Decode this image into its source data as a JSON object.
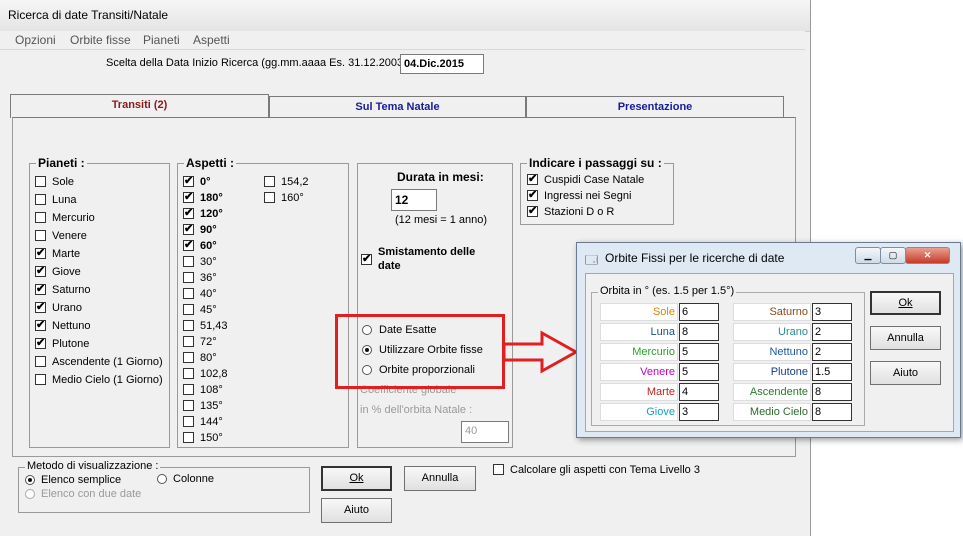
{
  "window": {
    "title": "Ricerca di date Transiti/Natale"
  },
  "menu": [
    "Opzioni",
    "Orbite fisse",
    "Pianeti",
    "Aspetti"
  ],
  "date_input": {
    "label": "Scelta della Data Inizio Ricerca (gg.mm.aaaa Es. 31.12.2003):",
    "value": "04.Dic.2015"
  },
  "tabs": [
    "Transiti (2)",
    "Sul Tema Natale",
    "Presentazione"
  ],
  "pianeti": {
    "label": "Pianeti :",
    "items": [
      {
        "label": "Sole",
        "checked": false
      },
      {
        "label": "Luna",
        "checked": false
      },
      {
        "label": "Mercurio",
        "checked": false
      },
      {
        "label": "Venere",
        "checked": false
      },
      {
        "label": "Marte",
        "checked": true
      },
      {
        "label": "Giove",
        "checked": true
      },
      {
        "label": "Saturno",
        "checked": true
      },
      {
        "label": "Urano",
        "checked": true
      },
      {
        "label": "Nettuno",
        "checked": true
      },
      {
        "label": "Plutone",
        "checked": true
      },
      {
        "label": "Ascendente (1 Giorno)",
        "checked": false
      },
      {
        "label": "Medio Cielo (1 Giorno)",
        "checked": false
      }
    ]
  },
  "aspetti": {
    "label": "Aspetti :",
    "col1": [
      {
        "label": "0°",
        "checked": true,
        "bold": true
      },
      {
        "label": "180°",
        "checked": true,
        "bold": true
      },
      {
        "label": "120°",
        "checked": true,
        "bold": true
      },
      {
        "label": "90°",
        "checked": true,
        "bold": true
      },
      {
        "label": "60°",
        "checked": true,
        "bold": true
      },
      {
        "label": "30°",
        "checked": false,
        "bold": false
      },
      {
        "label": "36°",
        "checked": false,
        "bold": false
      },
      {
        "label": "40°",
        "checked": false,
        "bold": false
      },
      {
        "label": "45°",
        "checked": false,
        "bold": false
      },
      {
        "label": "51,43",
        "checked": false,
        "bold": false
      },
      {
        "label": "72°",
        "checked": false,
        "bold": false
      },
      {
        "label": "80°",
        "checked": false,
        "bold": false
      },
      {
        "label": "102,8",
        "checked": false,
        "bold": false
      },
      {
        "label": "108°",
        "checked": false,
        "bold": false
      },
      {
        "label": "135°",
        "checked": false,
        "bold": false
      },
      {
        "label": "144°",
        "checked": false,
        "bold": false
      },
      {
        "label": "150°",
        "checked": false,
        "bold": false
      }
    ],
    "col2": [
      {
        "label": "154,2",
        "checked": false
      },
      {
        "label": "160°",
        "checked": false
      }
    ]
  },
  "durata": {
    "label": "Durata in mesi:",
    "value": "12",
    "note": "(12 mesi = 1 anno)",
    "smistamento": "Smistamento delle date",
    "smistamento_checked": true,
    "radios": [
      {
        "label": "Date Esatte",
        "selected": false
      },
      {
        "label": "Utilizzare Orbite fisse",
        "selected": true
      },
      {
        "label": "Orbite proporzionali",
        "selected": false
      }
    ],
    "coeff_line1": "Coefficiente globale",
    "coeff_line2": "in % dell'orbita Natale :",
    "coeff_value": "40"
  },
  "passaggi": {
    "label": "Indicare i passaggi su :",
    "items": [
      {
        "label": "Cuspidi Case Natale",
        "checked": true
      },
      {
        "label": "Ingressi nei Segni",
        "checked": true
      },
      {
        "label": "Stazioni D o R",
        "checked": true
      }
    ]
  },
  "metodo": {
    "label": "Metodo di visualizzazione :",
    "options": [
      {
        "label": "Elenco semplice",
        "selected": true,
        "disabled": false
      },
      {
        "label": "Colonne",
        "selected": false,
        "disabled": false
      },
      {
        "label": "Elenco con due date",
        "selected": false,
        "disabled": true
      }
    ]
  },
  "buttons": {
    "ok": "Ok",
    "annulla": "Annulla",
    "aiuto": "Aiuto"
  },
  "livello3": {
    "label": "Calcolare gli aspetti con Tema Livello 3",
    "checked": false
  },
  "popup": {
    "title": "Orbite Fissi per le ricerche di date",
    "group_label": "Orbita in ° (es. 1.5 per 1.5°)",
    "left": [
      {
        "name": "Sole",
        "value": "6",
        "color": "#e08000"
      },
      {
        "name": "Luna",
        "value": "8",
        "color": "#1a4f8a"
      },
      {
        "name": "Mercurio",
        "value": "5",
        "color": "#2aa02a"
      },
      {
        "name": "Venere",
        "value": "5",
        "color": "#c000c0"
      },
      {
        "name": "Marte",
        "value": "4",
        "color": "#c02020"
      },
      {
        "name": "Giove",
        "value": "3",
        "color": "#10a0c0"
      }
    ],
    "right": [
      {
        "name": "Saturno",
        "value": "3",
        "color": "#8a4a1a"
      },
      {
        "name": "Urano",
        "value": "2",
        "color": "#2a8a8a"
      },
      {
        "name": "Nettuno",
        "value": "2",
        "color": "#1a5aa0"
      },
      {
        "name": "Plutone",
        "value": "1.5",
        "color": "#1a3a8a"
      },
      {
        "name": "Ascendente",
        "value": "8",
        "color": "#2a7a2a"
      },
      {
        "name": "Medio Cielo",
        "value": "8",
        "color": "#2a6a2a"
      }
    ],
    "buttons": {
      "ok": "Ok",
      "annulla": "Annulla",
      "aiuto": "Aiuto"
    }
  }
}
